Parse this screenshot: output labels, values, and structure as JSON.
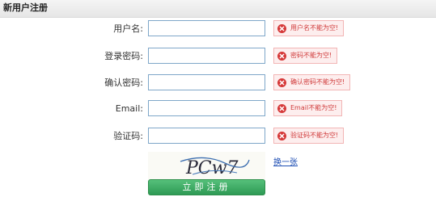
{
  "header": {
    "title": "新用户注册"
  },
  "form": {
    "fields": [
      {
        "label": "用户名:",
        "value": "",
        "error": "用户名不能为空!"
      },
      {
        "label": "登录密码:",
        "value": "",
        "error": "密码不能为空!"
      },
      {
        "label": "确认密码:",
        "value": "",
        "error": "确认密码不能为空!"
      },
      {
        "label": "Email:",
        "value": "",
        "error": "Email不能为空!"
      },
      {
        "label": "验证码:",
        "value": "",
        "error": "验证码不能为空!"
      }
    ],
    "captcha": {
      "text": "PCw7",
      "change_label": "换一张"
    },
    "submit_label": "立即注册"
  },
  "colors": {
    "error_text": "#d03a3a",
    "error_bg": "#fdeeee",
    "input_border": "#7fa7c9",
    "submit_bg": "#3aa35f",
    "link": "#1f4fb4"
  },
  "icons": {
    "error": "error-x-circle-icon"
  }
}
